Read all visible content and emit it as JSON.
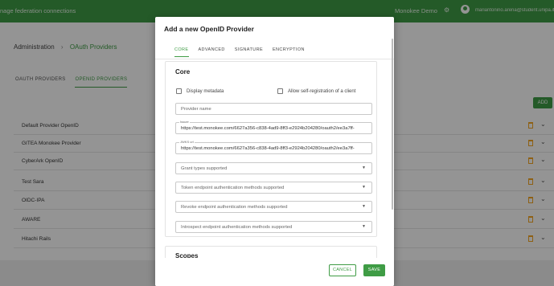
{
  "topbar": {
    "title": "nage federation connections",
    "app_name": "Monokee Demo",
    "user": "mariantonino.arena@student.unipa.it"
  },
  "breadcrumb": {
    "root": "Administration",
    "separator": "›",
    "current": "OAuth Providers"
  },
  "page_tabs": [
    "OAUTH PROVIDERS",
    "OPENID PROVIDERS"
  ],
  "add_label": "ADD",
  "providers": [
    "Default Provider OpenID",
    "GITEA Monokee Provider",
    "CyberArk OpenID",
    "Test Sara",
    "OIDC-IPA",
    "AWARE",
    "Hitachi Rails"
  ],
  "modal": {
    "title": "Add a new OpenID Provider",
    "tabs": [
      "CORE",
      "ADVANCED",
      "SIGNATURE",
      "ENCRYPTION"
    ],
    "section_title": "Core",
    "display_metadata": "Display metadata",
    "allow_self_reg": "Allow self-registration of a client",
    "provider_name_ph": "Provider name",
    "issuer_label": "Issuer",
    "issuer_value": "https://test.monokee.com/6627a356-c838-4ad9-8ff3-e2924b204280/oauth2/ee3a7ff-",
    "jwks_label": "JWKS url",
    "jwks_value": "https://test.monokee.com/6627a356-c838-4ad9-8ff3-e2924b204280/oauth2/ee3a7ff-",
    "grant_types": "Grant types supported",
    "token_auth": "Token endpoint authentication methods supported",
    "revoke_auth": "Revoke endpoint authentication methods supported",
    "introspect_auth": "Introspect endpoint authentication methods supported",
    "scopes_title": "Scopes",
    "cancel": "CANCEL",
    "save": "SAVE"
  },
  "colors": {
    "accent": "#3f9c45",
    "delete": "#f5a623"
  }
}
